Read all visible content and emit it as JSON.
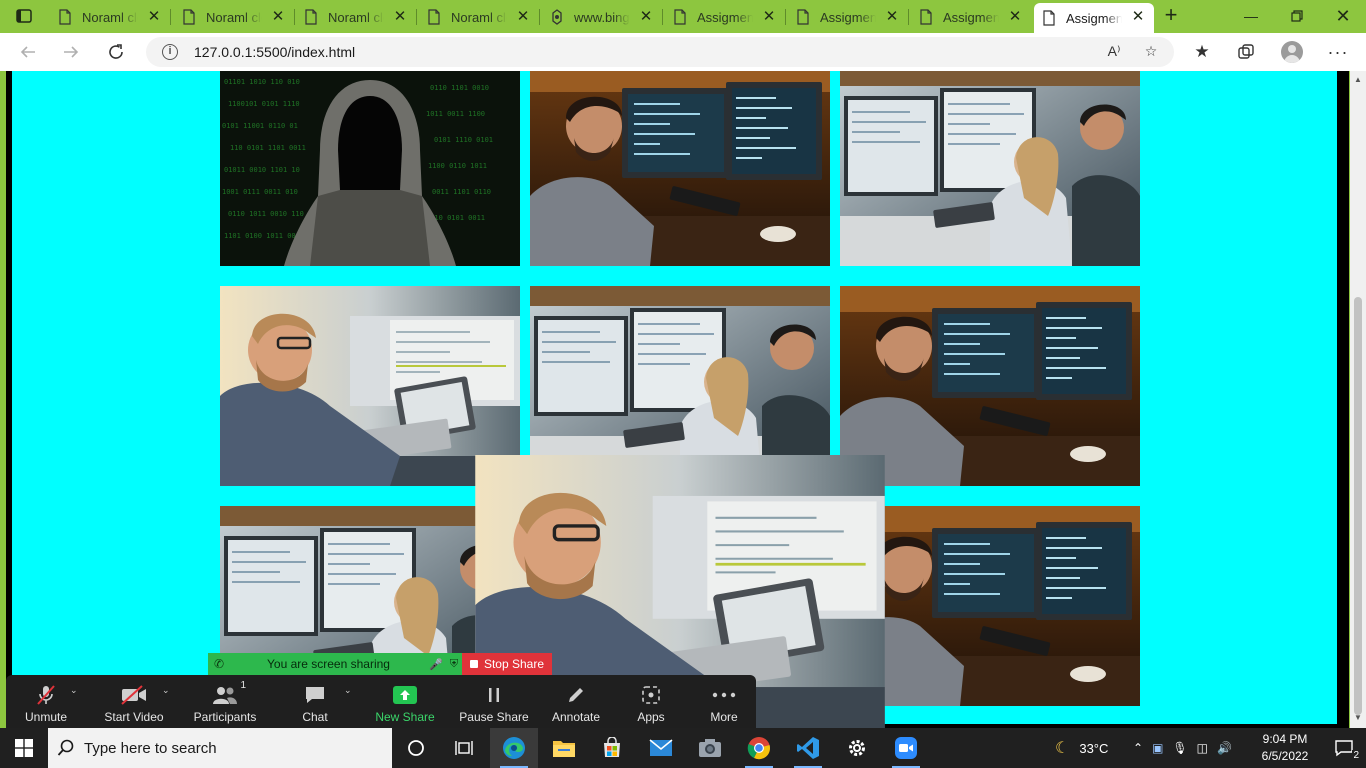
{
  "browser": {
    "tabs": [
      {
        "title": "Noraml clone",
        "active": false
      },
      {
        "title": "Noraml clone",
        "active": false
      },
      {
        "title": "Noraml clone",
        "active": false
      },
      {
        "title": "Noraml clone",
        "active": false
      },
      {
        "title": "www.bing.com",
        "active": false
      },
      {
        "title": "Assigment",
        "active": false
      },
      {
        "title": "Assigment",
        "active": false
      },
      {
        "title": "Assigment",
        "active": false
      },
      {
        "title": "Assigment",
        "active": true
      }
    ],
    "url": "127.0.0.1:5500/index.html",
    "page_background": "#00ffff"
  },
  "gallery": {
    "images": [
      {
        "subject": "hooded-hacker"
      },
      {
        "subject": "developer-at-monitors"
      },
      {
        "subject": "developers-pair"
      },
      {
        "subject": "developer-with-laptop"
      },
      {
        "subject": "developers-pair"
      },
      {
        "subject": "developer-at-monitors"
      },
      {
        "subject": "developers-pair"
      },
      {
        "subject": "developer-at-monitors"
      }
    ]
  },
  "zoom": {
    "share_status": "You are screen sharing",
    "stop_share_label": "Stop Share",
    "participants_count": "1",
    "buttons": {
      "unmute": "Unmute",
      "start_video": "Start Video",
      "participants": "Participants",
      "chat": "Chat",
      "new_share": "New Share",
      "pause_share": "Pause Share",
      "annotate": "Annotate",
      "apps": "Apps",
      "more": "More"
    }
  },
  "taskbar": {
    "search_placeholder": "Type here to search",
    "weather": "33°C",
    "time": "9:04 PM",
    "date": "6/5/2022",
    "notifications": "2"
  }
}
